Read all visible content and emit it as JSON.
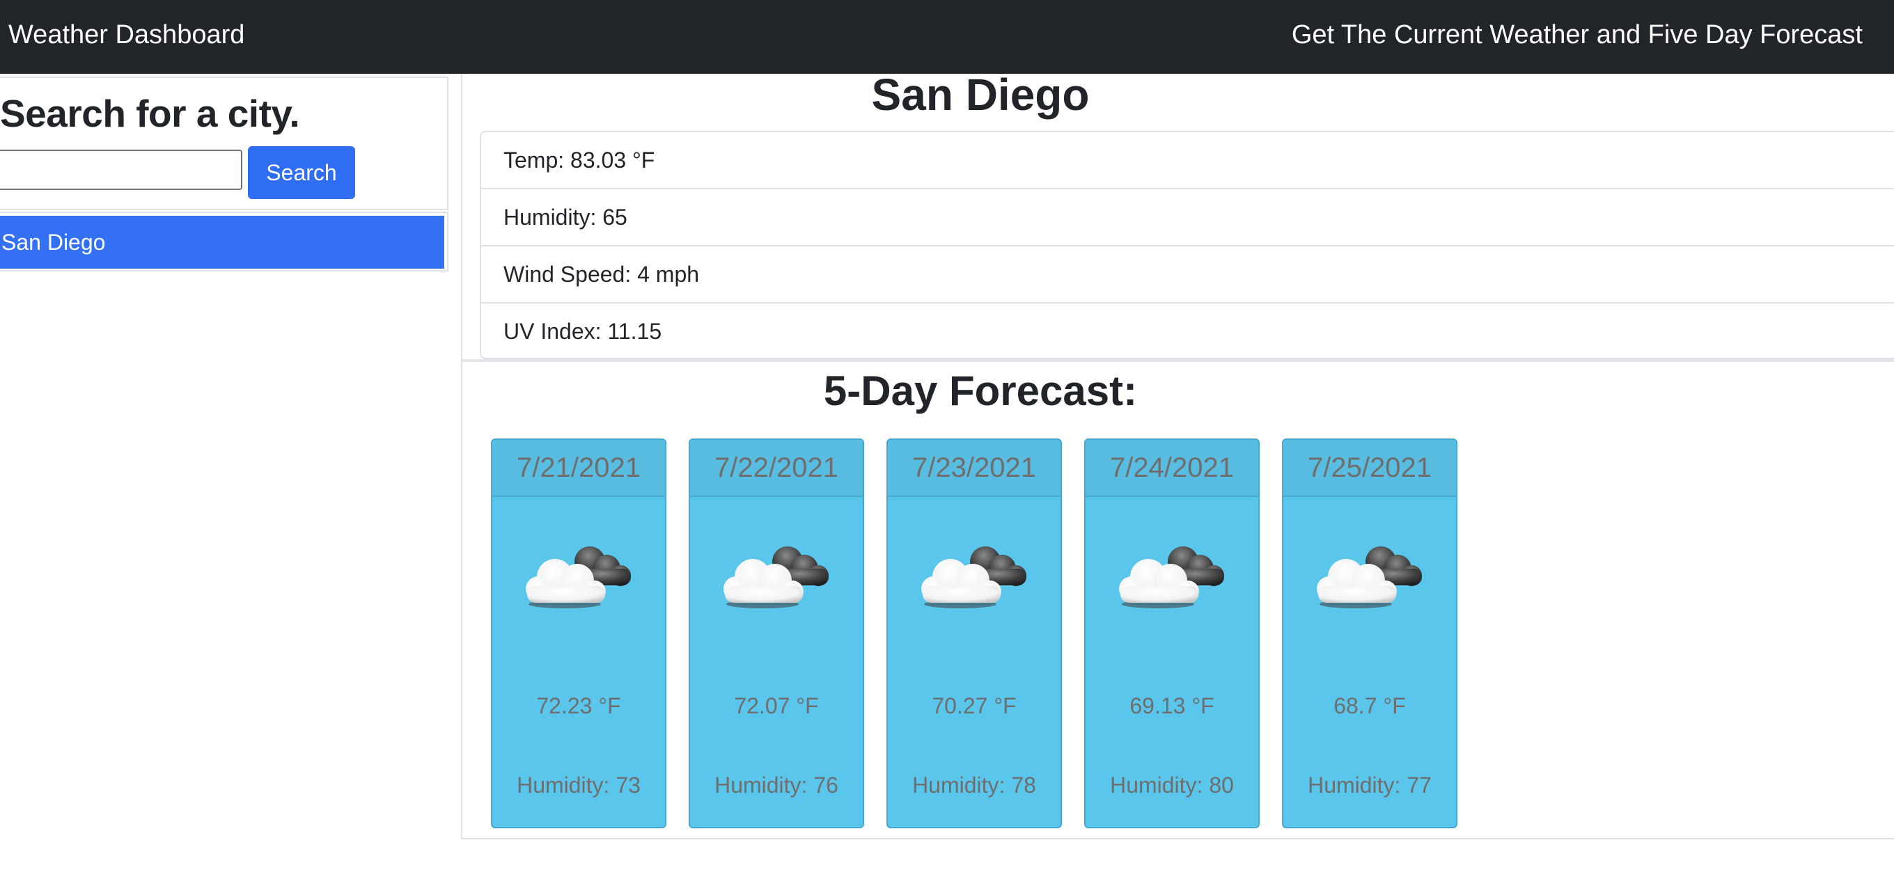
{
  "navbar": {
    "brand": "Weather Dashboard",
    "tagline": "Get The Current Weather and Five Day Forecast"
  },
  "sidebar": {
    "title": "Search for a city.",
    "search_input": {
      "value": "",
      "placeholder": ""
    },
    "search_button": "Search",
    "history": [
      "San Diego"
    ]
  },
  "current": {
    "city": "San Diego",
    "temp": "Temp: 83.03 °F",
    "humidity": "Humidity: 65",
    "wind": "Wind Speed: 4 mph",
    "uv": "UV Index: 11.15"
  },
  "forecast": {
    "title": "5-Day Forecast:",
    "days": [
      {
        "date": "7/21/2021",
        "icon": "partly-cloudy-icon",
        "temp": "72.23 °F",
        "humidity": "Humidity: 73"
      },
      {
        "date": "7/22/2021",
        "icon": "partly-cloudy-icon",
        "temp": "72.07 °F",
        "humidity": "Humidity: 76"
      },
      {
        "date": "7/23/2021",
        "icon": "partly-cloudy-icon",
        "temp": "70.27 °F",
        "humidity": "Humidity: 78"
      },
      {
        "date": "7/24/2021",
        "icon": "partly-cloudy-icon",
        "temp": "69.13 °F",
        "humidity": "Humidity: 80"
      },
      {
        "date": "7/25/2021",
        "icon": "partly-cloudy-icon",
        "temp": "68.7 °F",
        "humidity": "Humidity: 77"
      }
    ]
  },
  "colors": {
    "navbar_bg": "#212529",
    "primary": "#2f6ef3",
    "card_bg": "#5bc6eb"
  }
}
